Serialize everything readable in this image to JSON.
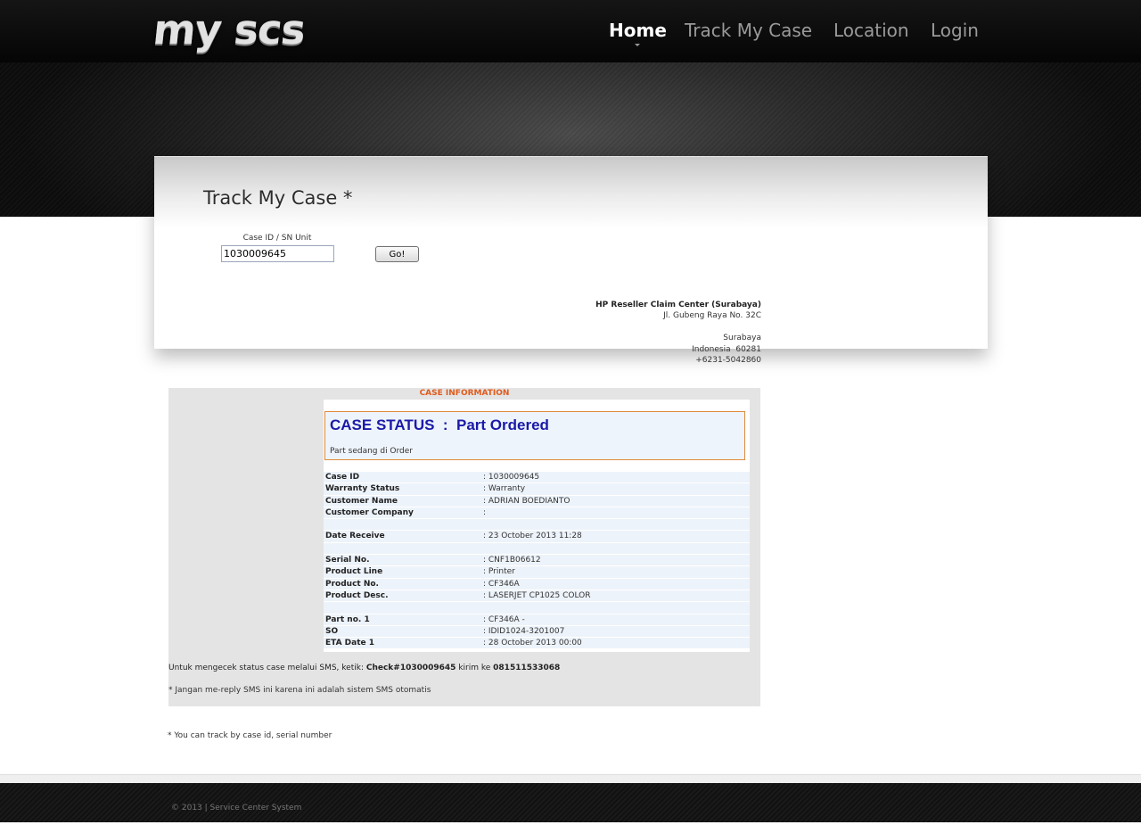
{
  "brand": {
    "logo_text": "my scs"
  },
  "nav": {
    "items": [
      {
        "label": "Home",
        "active": true
      },
      {
        "label": "Track My Case",
        "active": false
      },
      {
        "label": "Location",
        "active": false
      },
      {
        "label": "Login",
        "active": false
      }
    ]
  },
  "page": {
    "title": "Track My Case *"
  },
  "search": {
    "label": "Case ID / SN Unit",
    "value": "1030009645",
    "button_label": "Go!"
  },
  "service_center": {
    "name": "HP Reseller Claim Center (Surabaya)",
    "street": "Jl. Gubeng Raya No. 32C",
    "city": "Surabaya",
    "country_zip": "Indonesia  60281",
    "phone": "+6231-5042860"
  },
  "case": {
    "header": "CASE INFORMATION",
    "status_title": "CASE STATUS  :  Part Ordered",
    "status_desc": "Part sedang di Order",
    "details": [
      {
        "key": "Case ID",
        "value": ": 1030009645"
      },
      {
        "key": "Warranty Status",
        "value": ": Warranty"
      },
      {
        "key": "Customer Name",
        "value": ": ADRIAN BOEDIANTO"
      },
      {
        "key": "Customer Company",
        "value": ":"
      },
      {
        "key": "",
        "value": ""
      },
      {
        "key": "Date Receive",
        "value": ": 23 October 2013 11:28"
      },
      {
        "key": "",
        "value": ""
      },
      {
        "key": "Serial No.",
        "value": ": CNF1B06612"
      },
      {
        "key": "Product Line",
        "value": ": Printer"
      },
      {
        "key": "Product No.",
        "value": ": CF346A"
      },
      {
        "key": "Product Desc.",
        "value": ": LASERJET CP1025 COLOR"
      },
      {
        "key": "",
        "value": ""
      },
      {
        "key": "Part no. 1",
        "value": ": CF346A -"
      },
      {
        "key": "SO",
        "value": ": IDID1024-3201007"
      },
      {
        "key": "ETA Date 1",
        "value": ": 28 October 2013 00:00"
      }
    ],
    "sms_prefix": "Untuk mengecek status case melalui SMS, ketik: ",
    "sms_command": "Check#1030009645",
    "sms_middle": " kirim ke ",
    "sms_number": "081511533068",
    "sms_warning": "* Jangan me-reply SMS ini karena ini adalah sistem SMS otomatis"
  },
  "track_note": "* You can track by case id, serial number",
  "footer": {
    "copyright": "© 2013 | Service Center System"
  },
  "colors": {
    "accent_orange": "#e05a1c",
    "status_blue": "#1a1aa8",
    "header_black": "#0b0b0b"
  }
}
